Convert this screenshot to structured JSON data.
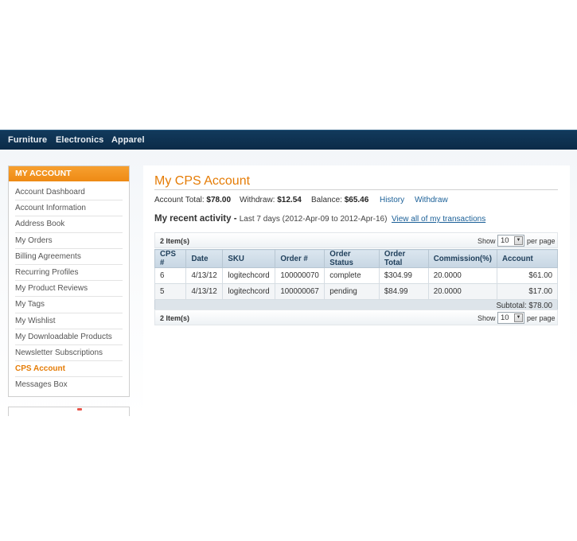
{
  "nav": {
    "items": [
      "Furniture",
      "Electronics",
      "Apparel"
    ]
  },
  "sidebar": {
    "title": "My Account",
    "items": [
      "Account Dashboard",
      "Account Information",
      "Address Book",
      "My Orders",
      "Billing Agreements",
      "Recurring Profiles",
      "My Product Reviews",
      "My Tags",
      "My Wishlist",
      "My Downloadable Products",
      "Newsletter Subscriptions",
      "CPS Account",
      "Messages Box"
    ],
    "active": "CPS Account"
  },
  "main": {
    "title": "My CPS Account",
    "summary": {
      "total_label": "Account Total:",
      "total_value": "$78.00",
      "withdraw_label": "Withdraw:",
      "withdraw_value": "$12.54",
      "balance_label": "Balance:",
      "balance_value": "$65.46",
      "history_link": "History",
      "withdraw_link": "Withdraw"
    },
    "activity": {
      "heading": "My recent activity",
      "separator": " - ",
      "range": "Last 7 days (2012-Apr-09 to 2012-Apr-16)",
      "view_all_link": "View all of my transactions"
    },
    "pager": {
      "count": "2 Item(s)",
      "show_label": "Show",
      "per_page_value": "10",
      "per_page_label": "per page"
    },
    "table": {
      "columns": [
        "CPS #",
        "Date",
        "SKU",
        "Order #",
        "Order Status",
        "Order Total",
        "Commission(%)",
        "Account"
      ],
      "rows": [
        [
          "6",
          "4/13/12",
          "logitechcord",
          "100000070",
          "complete",
          "$304.99",
          "20.0000",
          "$61.00"
        ],
        [
          "5",
          "4/13/12",
          "logitechcord",
          "100000067",
          "pending",
          "$84.99",
          "20.0000",
          "$17.00"
        ]
      ],
      "subtotal": "Subtotal: $78.00"
    }
  }
}
